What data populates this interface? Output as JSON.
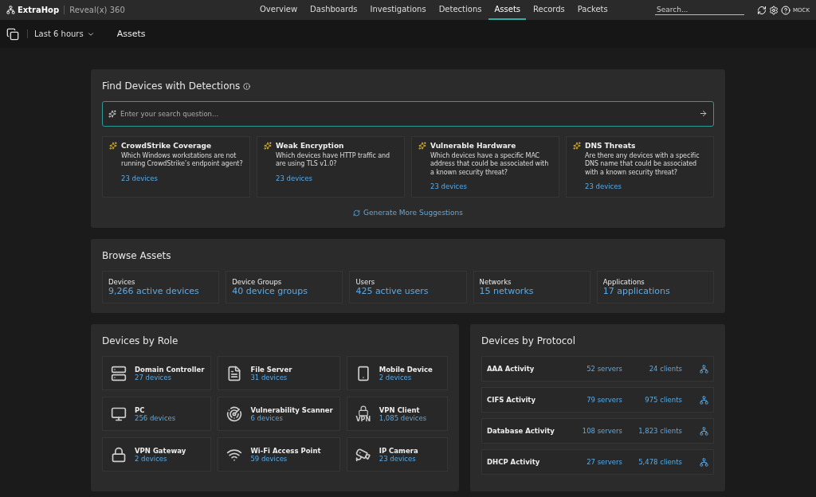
{
  "topbar": {
    "brand": "ExtraHop",
    "product": "Reveal(x) 360",
    "nav": [
      {
        "label": "Overview",
        "selected": false
      },
      {
        "label": "Dashboards",
        "selected": false
      },
      {
        "label": "Investigations",
        "selected": false
      },
      {
        "label": "Detections",
        "selected": false
      },
      {
        "label": "Assets",
        "selected": true
      },
      {
        "label": "Records",
        "selected": false
      },
      {
        "label": "Packets",
        "selected": false
      }
    ],
    "search": {
      "placeholder": "Search..."
    },
    "mode": "MOCK"
  },
  "toolbar": {
    "time_range": "Last 6 hours",
    "page_title": "Assets"
  },
  "find": {
    "title": "Find Devices with Detections",
    "search": {
      "placeholder": "Enter your search question..."
    },
    "suggestions": [
      {
        "title": "CrowdStrike Coverage",
        "question": "Which Windows workstations are not running CrowdStrike’s endpoint agent?",
        "count": "23 devices"
      },
      {
        "title": "Weak Encryption",
        "question": "Which devices have HTTP traffic and are using TLS v1.0?",
        "count": "23 devices"
      },
      {
        "title": "Vulnerable Hardware",
        "question": "Which devices have a specific MAC address that could be associated with a known security threat?",
        "count": "23 devices"
      },
      {
        "title": "DNS Threats",
        "question": "Are there any devices with a specific DNS name that could be associated with a known security threat?",
        "count": "23 devices"
      }
    ],
    "generate": "Generate More Suggestions"
  },
  "browse": {
    "title": "Browse Assets",
    "items": [
      {
        "label": "Devices",
        "value": "9,266 active devices"
      },
      {
        "label": "Device Groups",
        "value": "40 device groups"
      },
      {
        "label": "Users",
        "value": "425 active users"
      },
      {
        "label": "Networks",
        "value": "15 networks"
      },
      {
        "label": "Applications",
        "value": "17 applications"
      }
    ]
  },
  "roles": {
    "title": "Devices by Role",
    "items": [
      {
        "name": "Domain Controller",
        "count": "27 devices"
      },
      {
        "name": "File Server",
        "count": "31 devices"
      },
      {
        "name": "Mobile Device",
        "count": "2 devices"
      },
      {
        "name": "PC",
        "count": "256 devices"
      },
      {
        "name": "Vulnerability Scanner",
        "count": "6 devices"
      },
      {
        "name": "VPN Client",
        "count": "1,085 devices",
        "badge": "VPN"
      },
      {
        "name": "VPN Gateway",
        "count": "2 devices"
      },
      {
        "name": "Wi-Fi Access Point",
        "count": "59 devices"
      },
      {
        "name": "IP Camera",
        "count": "23 devices"
      }
    ]
  },
  "protocols": {
    "title": "Devices by Protocol",
    "rows": [
      {
        "name": "AAA Activity",
        "servers": "52 servers",
        "clients": "24 clients"
      },
      {
        "name": "CIFS Activity",
        "servers": "79 servers",
        "clients": "975 clients"
      },
      {
        "name": "Database Activity",
        "servers": "108 servers",
        "clients": "1,823 clients"
      },
      {
        "name": "DHCP Activity",
        "servers": "27 servers",
        "clients": "5,478 clients"
      }
    ]
  }
}
